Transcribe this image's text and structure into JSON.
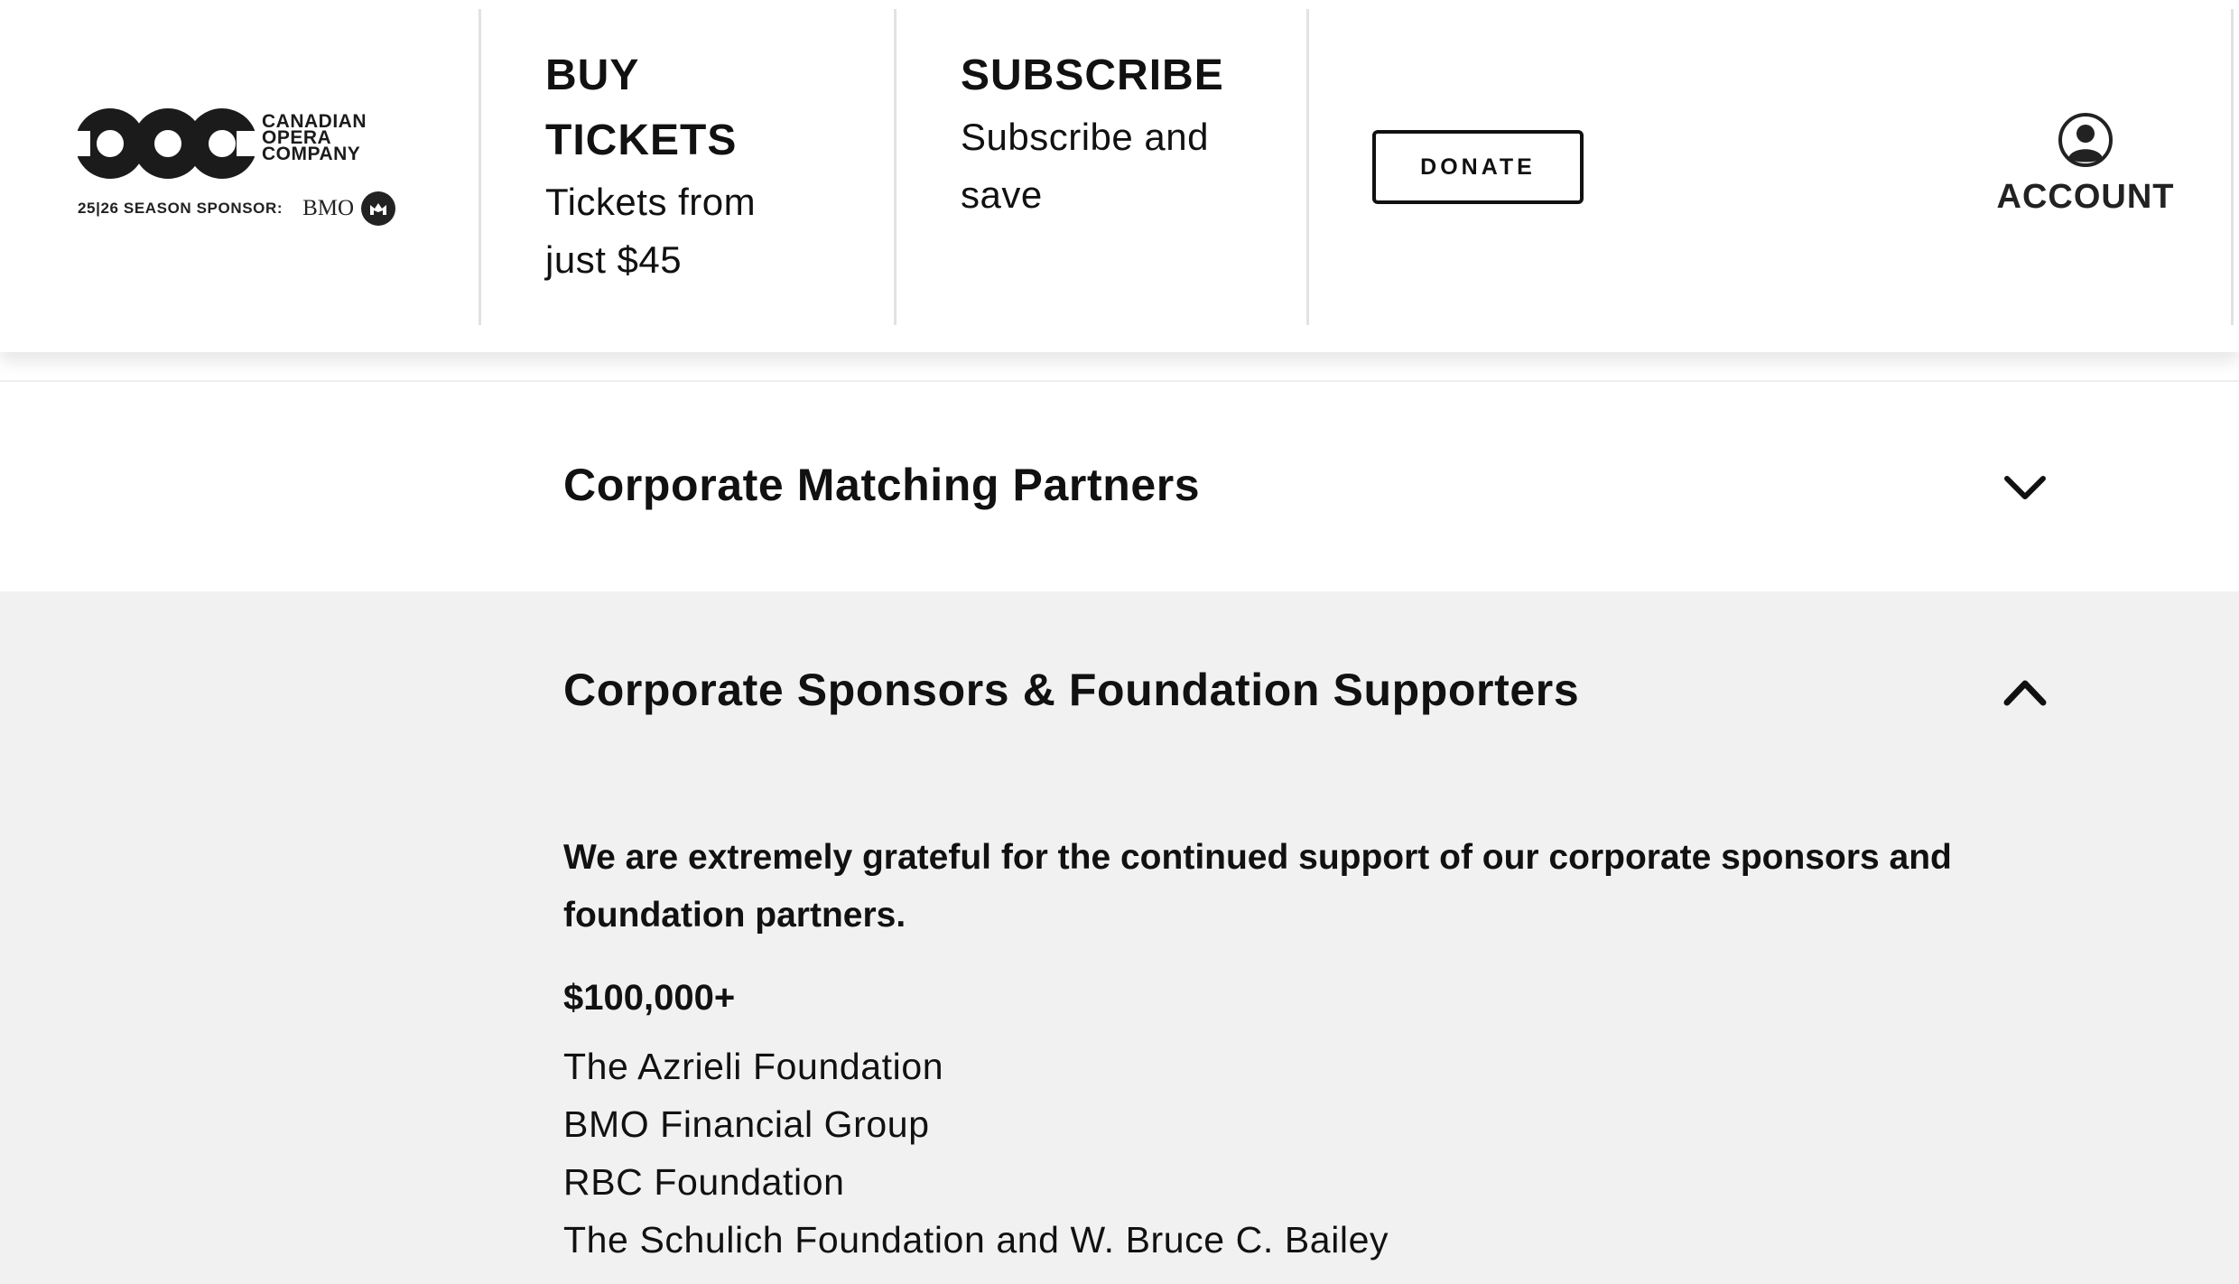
{
  "header": {
    "logo": {
      "line1": "CANADIAN",
      "line2": "OPERA",
      "line3": "COMPANY",
      "sponsor_text": "25|26 SEASON SPONSOR:",
      "sponsor_brand": "BMO"
    },
    "buy_tickets": {
      "title_line1": "BUY",
      "title_line2": "TICKETS",
      "sub_line1": "Tickets from",
      "sub_line2": "just $45"
    },
    "subscribe": {
      "title": "SUBSCRIBE",
      "sub_line1": "Subscribe and",
      "sub_line2": "save"
    },
    "donate_label": "DONATE",
    "account_label": "ACCOUNT",
    "icons": {
      "logo": "coc-rings-logo",
      "bmo": "bmo-roundel-icon",
      "account": "user-circle-icon"
    }
  },
  "accordion": {
    "sections": [
      {
        "title": "Corporate Matching Partners",
        "state": "collapsed",
        "icon": "chevron-down-icon"
      },
      {
        "title": "Corporate Sponsors & Foundation Supporters",
        "state": "expanded",
        "icon": "chevron-up-icon",
        "intro": "We are extremely grateful for the continued support of our corporate sponsors and foundation partners.",
        "tier_label": "$100,000+",
        "supporters": [
          "The Azrieli Foundation",
          "BMO Financial Group",
          "RBC Foundation",
          "The Schulich Foundation and W. Bruce C. Bailey"
        ]
      }
    ]
  },
  "colors": {
    "text": "#111111",
    "panel_background": "#f1f1f1",
    "divider": "#e2e2e2",
    "page_background": "#ffffff"
  }
}
